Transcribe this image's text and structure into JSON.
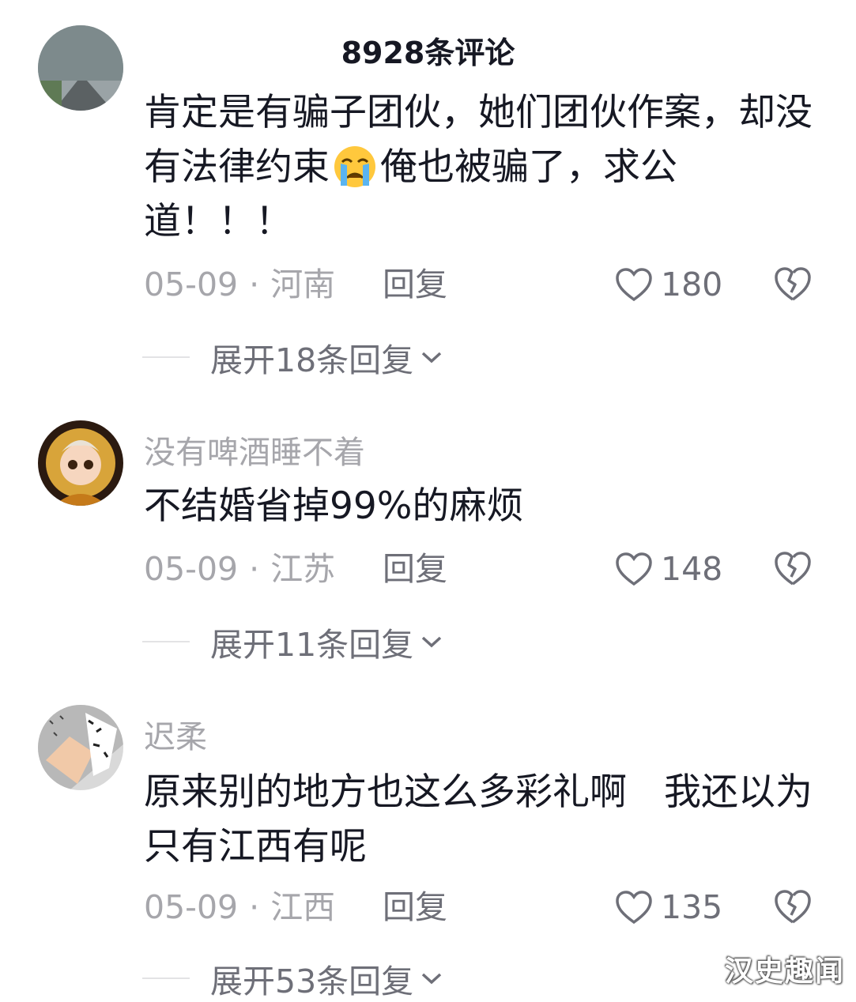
{
  "header": {
    "title": "8928条评论"
  },
  "comments": [
    {
      "username": "",
      "text_before_emoji": "肯定是有骗子团伙，她们团伙作案，却没有法律约束",
      "emoji": "crying-face-icon",
      "text_after_emoji": "俺也被骗了，求公道！！！",
      "date": "05-09",
      "separator": "·",
      "location": "河南",
      "reply_label": "回复",
      "likes": "180",
      "expand_label": "展开18条回复"
    },
    {
      "username": "没有啤酒睡不着",
      "text": "不结婚省掉99%的麻烦",
      "date": "05-09",
      "separator": "·",
      "location": "江苏",
      "reply_label": "回复",
      "likes": "148",
      "expand_label": "展开11条回复"
    },
    {
      "username": "迟柔",
      "text": "原来别的地方也这么多彩礼啊　我还以为只有江西有呢",
      "date": "05-09",
      "separator": "·",
      "location": "江西",
      "reply_label": "回复",
      "likes": "135",
      "expand_label": "展开53条回复"
    }
  ],
  "watermark": "汉史趣闻",
  "colors": {
    "text": "#161823",
    "muted": "#a6a6ab",
    "secondary": "#6e6f78"
  }
}
